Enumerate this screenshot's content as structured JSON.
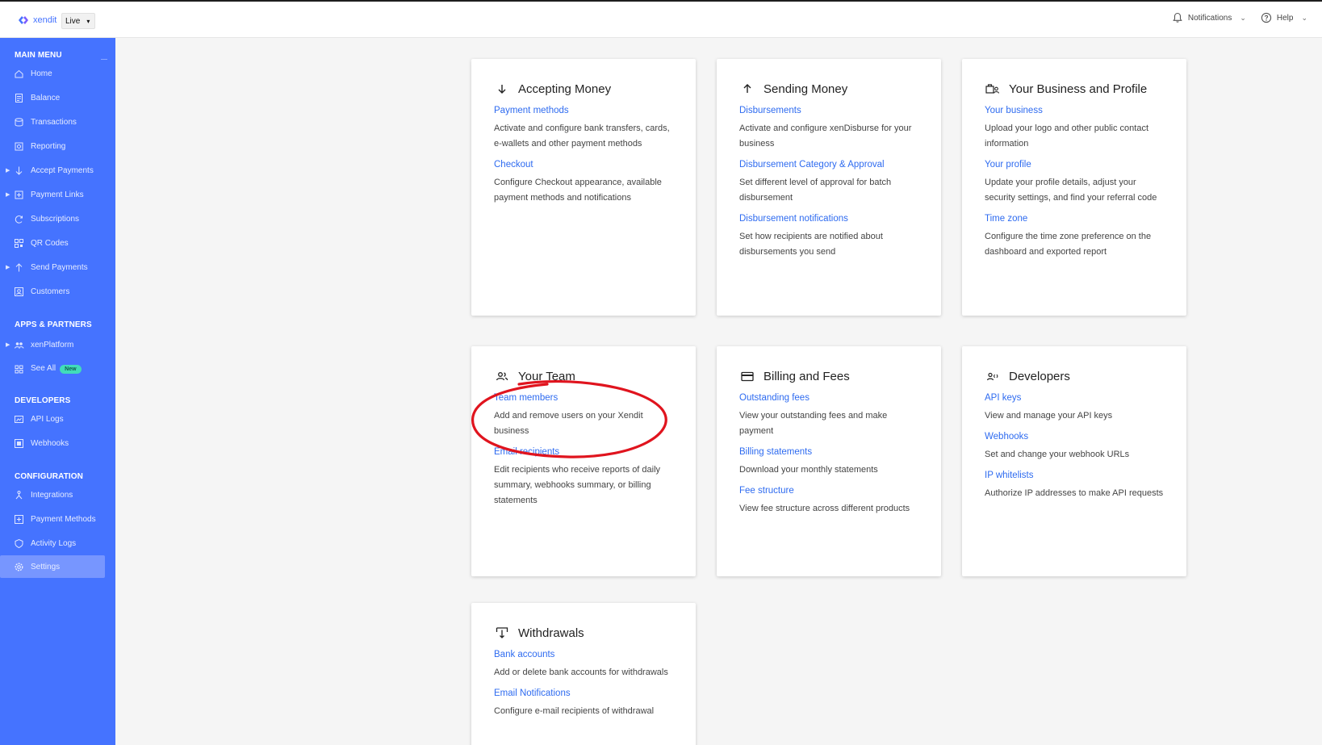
{
  "topbar": {
    "brand_name": "xendit",
    "env_selected": "Live",
    "notifications_label": "Notifications",
    "help_label": "Help",
    "icons": {
      "logo": "xendit-logo-icon",
      "notifications": "bell-icon",
      "help": "help-circle-icon"
    }
  },
  "sidebar": {
    "sections": {
      "main_menu": "MAIN MENU",
      "apps_partners": "APPS & PARTNERS",
      "developers": "DEVELOPERS",
      "configuration": "CONFIGURATION"
    },
    "main_items": [
      {
        "label": "Home",
        "icon": "home-icon"
      },
      {
        "label": "Balance",
        "icon": "balance-icon"
      },
      {
        "label": "Transactions",
        "icon": "transactions-icon"
      },
      {
        "label": "Reporting",
        "icon": "reporting-icon"
      },
      {
        "label": "Accept Payments",
        "icon": "accept-payments-icon"
      },
      {
        "label": "Payment Links",
        "icon": "payment-links-icon"
      },
      {
        "label": "Subscriptions",
        "icon": "subscriptions-icon"
      },
      {
        "label": "QR Codes",
        "icon": "qr-code-icon"
      },
      {
        "label": "Send Payments",
        "icon": "send-payments-icon"
      },
      {
        "label": "Customers",
        "icon": "customers-icon"
      }
    ],
    "apps_items": [
      {
        "label": "xenPlatform",
        "icon": "xenplatform-icon"
      },
      {
        "label": "See All",
        "icon": "grid-icon",
        "badge": "New"
      }
    ],
    "developer_items": [
      {
        "label": "API Logs",
        "icon": "api-logs-icon"
      },
      {
        "label": "Webhooks",
        "icon": "webhooks-icon"
      }
    ],
    "config_items": [
      {
        "label": "Integrations",
        "icon": "integrations-icon"
      },
      {
        "label": "Payment Methods",
        "icon": "payment-methods-icon"
      },
      {
        "label": "Activity Logs",
        "icon": "activity-logs-icon"
      },
      {
        "label": "Settings",
        "icon": "settings-icon",
        "active": true
      }
    ]
  },
  "cards": {
    "accepting_money": {
      "title": "Accepting Money",
      "icon": "arrow-down-icon",
      "links": [
        {
          "label": "Payment methods",
          "desc": "Activate and configure bank transfers, cards, e-wallets and other payment methods"
        },
        {
          "label": "Checkout",
          "desc": "Configure Checkout appearance, available payment methods and notifications"
        }
      ]
    },
    "sending_money": {
      "title": "Sending Money",
      "icon": "arrow-up-icon",
      "links": [
        {
          "label": "Disbursements",
          "desc": "Activate and configure xenDisburse for your business"
        },
        {
          "label": "Disbursement Category & Approval",
          "desc": "Set different level of approval for batch disbursement"
        },
        {
          "label": "Disbursement notifications",
          "desc": "Set how recipients are notified about disbursements you send"
        }
      ]
    },
    "business_profile": {
      "title": "Your Business and Profile",
      "icon": "business-profile-icon",
      "links": [
        {
          "label": "Your business",
          "desc": "Upload your logo and other public contact information"
        },
        {
          "label": "Your profile",
          "desc": "Update your profile details, adjust your security settings, and find your referral code"
        },
        {
          "label": "Time zone",
          "desc": "Configure the time zone preference on the dashboard and exported report"
        }
      ]
    },
    "your_team": {
      "title": "Your Team",
      "icon": "team-icon",
      "links": [
        {
          "label": "Team members",
          "desc": "Add and remove users on your Xendit business"
        },
        {
          "label": "Email recipients",
          "desc": "Edit recipients who receive reports of daily summary, webhooks summary, or billing statements"
        }
      ]
    },
    "billing_fees": {
      "title": "Billing and Fees",
      "icon": "credit-card-icon",
      "links": [
        {
          "label": "Outstanding fees",
          "desc": "View your outstanding fees and make payment"
        },
        {
          "label": "Billing statements",
          "desc": "Download your monthly statements"
        },
        {
          "label": "Fee structure",
          "desc": "View fee structure across different products"
        }
      ]
    },
    "developers": {
      "title": "Developers",
      "icon": "developer-icon",
      "links": [
        {
          "label": "API keys",
          "desc": "View and manage your API keys"
        },
        {
          "label": "Webhooks",
          "desc": "Set and change your webhook URLs"
        },
        {
          "label": "IP whitelists",
          "desc": "Authorize IP addresses to make API requests"
        }
      ]
    },
    "withdrawals": {
      "title": "Withdrawals",
      "icon": "withdraw-icon",
      "links": [
        {
          "label": "Bank accounts",
          "desc": "Add or delete bank accounts for withdrawals"
        },
        {
          "label": "Email Notifications",
          "desc": "Configure e-mail recipients of withdrawal"
        }
      ]
    }
  },
  "colors": {
    "sidebar_bg": "#4573ff",
    "link": "#2e6bf0",
    "annotation": "#e0141e"
  }
}
